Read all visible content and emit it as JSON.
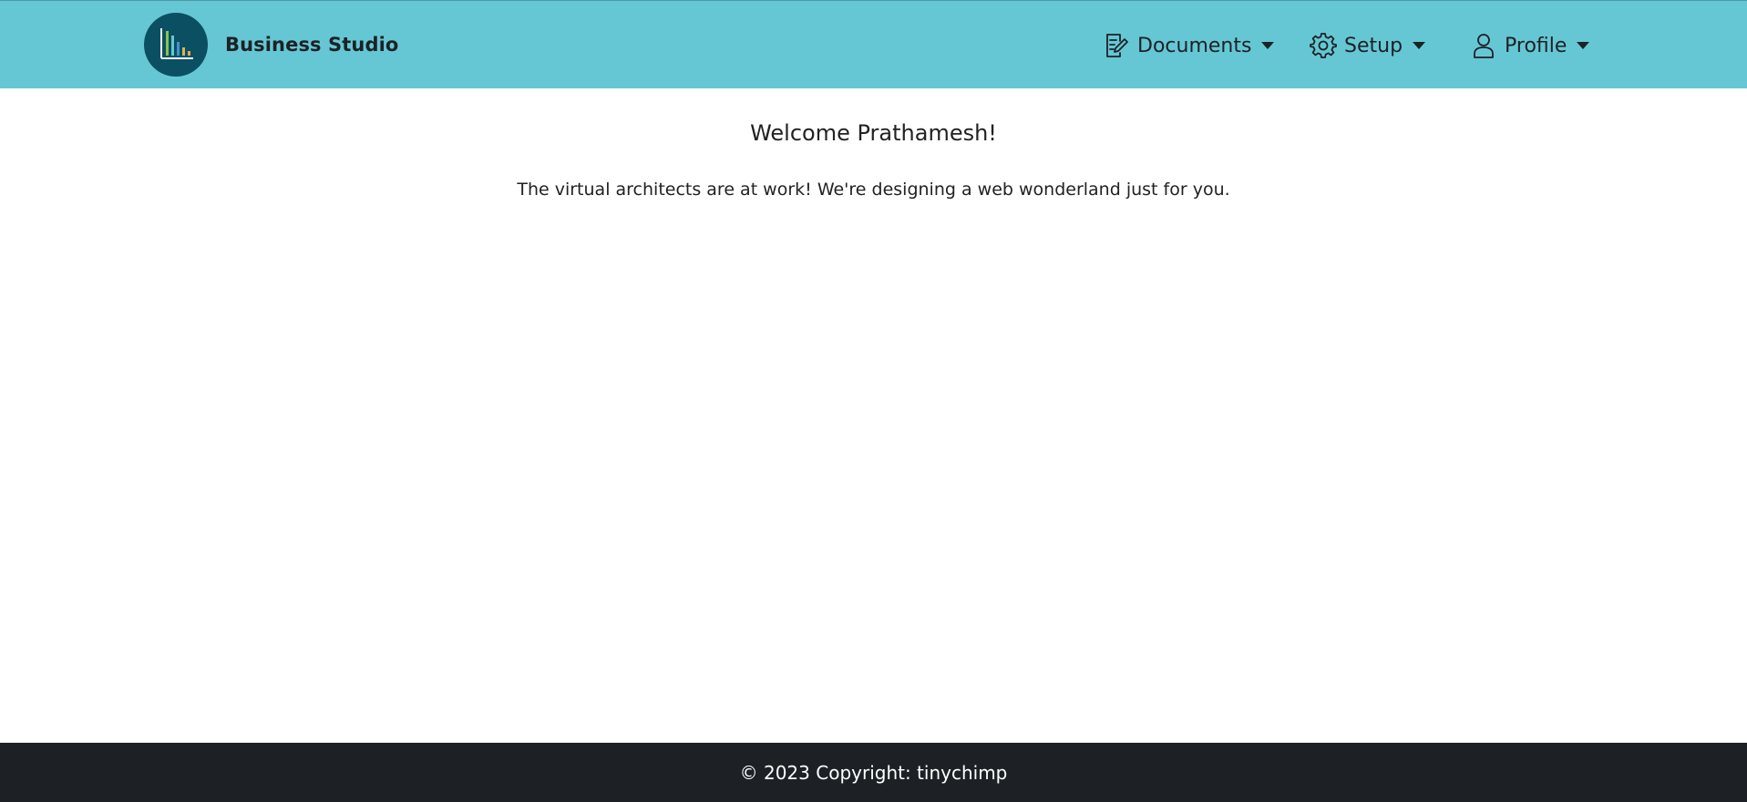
{
  "header": {
    "brand_name": "Business Studio",
    "logo_icon": "bar-chart-icon",
    "nav": [
      {
        "label": "Documents",
        "icon": "edit-document-icon"
      },
      {
        "label": "Setup",
        "icon": "gear-icon"
      },
      {
        "label": "Profile",
        "icon": "user-icon"
      }
    ],
    "colors": {
      "navbar_bg": "#66c7d4",
      "logo_bg": "#0b4f63"
    }
  },
  "main": {
    "welcome": "Welcome Prathamesh!",
    "message": "The virtual architects are at work! We're designing a web wonderland just for you."
  },
  "footer": {
    "copyright": "© 2023 Copyright: tinychimp",
    "bg_color": "#1d2125"
  }
}
